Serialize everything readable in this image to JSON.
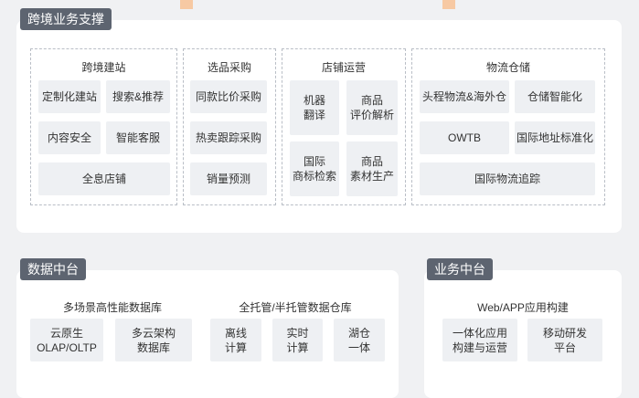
{
  "colors": {
    "tag_bg": "#5d6470",
    "card_bg": "#eef0f3",
    "accent": "#f7c9a3",
    "panel_bg": "#ffffff",
    "page_bg": "#f0f1f3"
  },
  "cross_border": {
    "title": "跨境业务支撑",
    "groups": [
      {
        "title": "跨境建站",
        "items": [
          "定制化建站",
          "搜索&推荐",
          "内容安全",
          "智能客服",
          "全息店铺"
        ]
      },
      {
        "title": "选品采购",
        "items": [
          "同款比价采购",
          "热卖跟踪采购",
          "销量预测"
        ]
      },
      {
        "title": "店铺运营",
        "items": [
          [
            "机器",
            "翻译"
          ],
          [
            "商品",
            "评价解析"
          ],
          [
            "国际",
            "商标检索"
          ],
          [
            "商品",
            "素材生产"
          ]
        ]
      },
      {
        "title": "物流仓储",
        "items": [
          "头程物流&海外仓",
          "仓储智能化",
          "OWTB",
          "国际地址标准化",
          "国际物流追踪"
        ]
      }
    ]
  },
  "data_platform": {
    "title": "数据中台",
    "groups": [
      {
        "title": "多场景高性能数据库",
        "items": [
          [
            "云原生",
            "OLAP/OLTP"
          ],
          [
            "多云架构",
            "数据库"
          ]
        ]
      },
      {
        "title": "全托管/半托管数据仓库",
        "items": [
          [
            "离线",
            "计算"
          ],
          [
            "实时",
            "计算"
          ],
          [
            "湖仓",
            "一体"
          ]
        ]
      }
    ]
  },
  "business_platform": {
    "title": "业务中台",
    "groups": [
      {
        "title": "Web/APP应用构建",
        "items": [
          [
            "一体化应用",
            "构建与运营"
          ],
          [
            "移动研发",
            "平台"
          ]
        ]
      }
    ]
  }
}
